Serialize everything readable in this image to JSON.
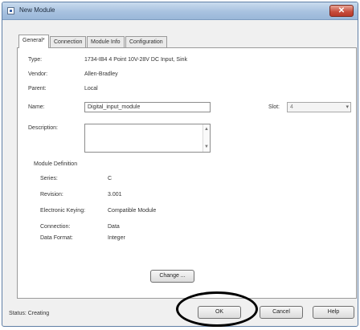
{
  "window": {
    "title": "New Module",
    "close_glyph": "✕"
  },
  "tabs": [
    {
      "label": "General*",
      "active": true
    },
    {
      "label": "Connection",
      "active": false
    },
    {
      "label": "Module Info",
      "active": false
    },
    {
      "label": "Configuration",
      "active": false
    }
  ],
  "general": {
    "type_label": "Type:",
    "type_value": "1734-IB4 4 Point 10V-28V DC Input, Sink",
    "vendor_label": "Vendor:",
    "vendor_value": "Allen-Bradley",
    "parent_label": "Parent:",
    "parent_value": "Local",
    "name_label": "Name:",
    "name_value": "Digital_input_module",
    "slot_label": "Slot:",
    "slot_value": "4",
    "description_label": "Description:",
    "description_value": ""
  },
  "module_definition": {
    "heading": "Module Definition",
    "series_label": "Series:",
    "series_value": "C",
    "revision_label": "Revision:",
    "revision_value": "3.001",
    "keying_label": "Electronic Keying:",
    "keying_value": "Compatible Module",
    "connection_label": "Connection:",
    "connection_value": "Data",
    "data_format_label": "Data Format:",
    "data_format_value": "Integer",
    "change_button": "Change ..."
  },
  "footer": {
    "status_text": "Status: Creating",
    "ok_button": "OK",
    "cancel_button": "Cancel",
    "help_button": "Help"
  },
  "colors": {
    "annotation": "#000000",
    "titlebar": "#a8c2e0",
    "close": "#c64b3a"
  }
}
